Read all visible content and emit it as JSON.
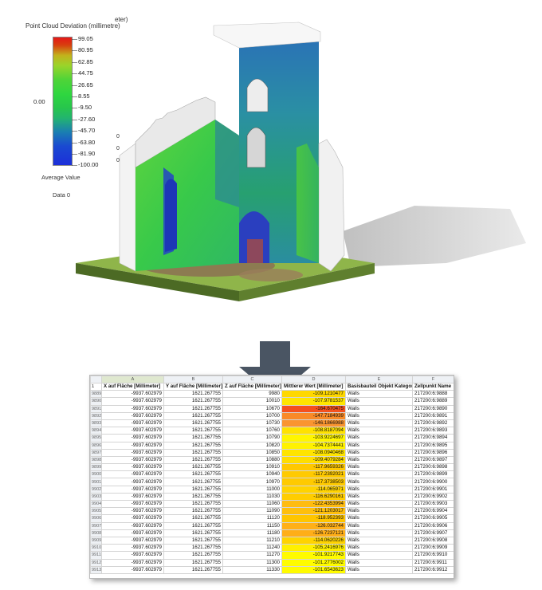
{
  "legend": {
    "title": "Point Cloud Deviation (millimetre)",
    "title_truncated_suffix": "eter)",
    "ticks": [
      "99.05",
      "80.95",
      "62.85",
      "44.75",
      "26.65",
      "8.55",
      "-9.50",
      "-27.60",
      "-45.70",
      "-63.80",
      "-81.90",
      "-100.00"
    ],
    "zero_label": "0.00",
    "average_label": "Average Value",
    "data_label": "Data 0",
    "stray_marks": [
      "0",
      "0",
      "0"
    ]
  },
  "colors": {
    "high": "#e51818",
    "mid": "#2ed640",
    "low": "#1c2fd9",
    "highlight_yellow": "#ffff00",
    "highlight_orange": "#ff7f1e"
  },
  "sheet": {
    "column_letters": [
      "A",
      "B",
      "C",
      "D",
      "E",
      "F"
    ],
    "header_row_number": "1",
    "headers": [
      "X auf Fläche [Millimeter]",
      "Y auf Fläche [Millimeter]",
      "Z auf Fläche [Millimeter]",
      "Mittlerer Wert [Millimeter]",
      "Basisbauteil Objekt Kategorie",
      "Zellpunkt Name"
    ],
    "rows": [
      {
        "n": "9889",
        "x": "-9937.602979",
        "y": "1621.267755",
        "z": "9980",
        "d": "-109.1210477",
        "cat": "Walls",
        "name": "217200:6:9888",
        "color": "#ffd800"
      },
      {
        "n": "9890",
        "x": "-9937.602979",
        "y": "1621.267755",
        "z": "10010",
        "d": "-107.9781537",
        "cat": "Walls",
        "name": "217200:6:9889",
        "color": "#ffe600"
      },
      {
        "n": "9891",
        "x": "-9937.602979",
        "y": "1621.267755",
        "z": "10670",
        "d": "-164.670475",
        "cat": "Walls",
        "name": "217200:6:9890",
        "color": "#f4511e"
      },
      {
        "n": "9892",
        "x": "-9937.602979",
        "y": "1621.267755",
        "z": "10700",
        "d": "-147.7184939",
        "cat": "Walls",
        "name": "217200:6:9891",
        "color": "#f98a28"
      },
      {
        "n": "9893",
        "x": "-9937.602979",
        "y": "1621.267755",
        "z": "10730",
        "d": "-146.1866988",
        "cat": "Walls",
        "name": "217200:6:9892",
        "color": "#fa9530"
      },
      {
        "n": "9894",
        "x": "-9937.602979",
        "y": "1621.267755",
        "z": "10760",
        "d": "-108.8187094",
        "cat": "Walls",
        "name": "217200:6:9893",
        "color": "#ffe200"
      },
      {
        "n": "9895",
        "x": "-9937.602979",
        "y": "1621.267755",
        "z": "10790",
        "d": "-103.9224697",
        "cat": "Walls",
        "name": "217200:6:9894",
        "color": "#fff600"
      },
      {
        "n": "9896",
        "x": "-9937.602979",
        "y": "1621.267755",
        "z": "10820",
        "d": "-104.7374441",
        "cat": "Walls",
        "name": "217200:6:9895",
        "color": "#fff200"
      },
      {
        "n": "9897",
        "x": "-9937.602979",
        "y": "1621.267755",
        "z": "10850",
        "d": "-108.0940468",
        "cat": "Walls",
        "name": "217200:6:9896",
        "color": "#ffe400"
      },
      {
        "n": "9898",
        "x": "-9937.602979",
        "y": "1621.267755",
        "z": "10880",
        "d": "-109.4079284",
        "cat": "Walls",
        "name": "217200:6:9897",
        "color": "#ffdd00"
      },
      {
        "n": "9899",
        "x": "-9937.602979",
        "y": "1621.267755",
        "z": "10910",
        "d": "-117.9659326",
        "cat": "Walls",
        "name": "217200:6:9898",
        "color": "#ffc800"
      },
      {
        "n": "9900",
        "x": "-9937.602979",
        "y": "1621.267755",
        "z": "10940",
        "d": "-117.2392021",
        "cat": "Walls",
        "name": "217200:6:9899",
        "color": "#ffca00"
      },
      {
        "n": "9901",
        "x": "-9937.602979",
        "y": "1621.267755",
        "z": "10970",
        "d": "-117.3738503",
        "cat": "Walls",
        "name": "217200:6:9900",
        "color": "#ffca00"
      },
      {
        "n": "9902",
        "x": "-9937.602979",
        "y": "1621.267755",
        "z": "11000",
        "d": "-114.065971",
        "cat": "Walls",
        "name": "217200:6:9901",
        "color": "#ffd300"
      },
      {
        "n": "9903",
        "x": "-9937.602979",
        "y": "1621.267755",
        "z": "11030",
        "d": "-116.6290161",
        "cat": "Walls",
        "name": "217200:6:9902",
        "color": "#ffcd00"
      },
      {
        "n": "9904",
        "x": "-9937.602979",
        "y": "1621.267755",
        "z": "11060",
        "d": "-122.4353994",
        "cat": "Walls",
        "name": "217200:6:9903",
        "color": "#ffbc10"
      },
      {
        "n": "9905",
        "x": "-9937.602979",
        "y": "1621.267755",
        "z": "11090",
        "d": "-121.1203017",
        "cat": "Walls",
        "name": "217200:6:9904",
        "color": "#ffbf0c"
      },
      {
        "n": "9906",
        "x": "-9937.602979",
        "y": "1621.267755",
        "z": "11120",
        "d": "-118.952393",
        "cat": "Walls",
        "name": "217200:6:9905",
        "color": "#ffc500"
      },
      {
        "n": "9907",
        "x": "-9937.602979",
        "y": "1621.267755",
        "z": "11150",
        "d": "-126.032744",
        "cat": "Walls",
        "name": "217200:6:9906",
        "color": "#ffb018"
      },
      {
        "n": "9908",
        "x": "-9937.602979",
        "y": "1621.267755",
        "z": "11180",
        "d": "-126.7237121",
        "cat": "Walls",
        "name": "217200:6:9907",
        "color": "#ffae18"
      },
      {
        "n": "9909",
        "x": "-9937.602979",
        "y": "1621.267755",
        "z": "11210",
        "d": "-114.0620226",
        "cat": "Walls",
        "name": "217200:6:9908",
        "color": "#ffd300"
      },
      {
        "n": "9910",
        "x": "-9937.602979",
        "y": "1621.267755",
        "z": "11240",
        "d": "-105.2416976",
        "cat": "Walls",
        "name": "217200:6:9909",
        "color": "#fff000"
      },
      {
        "n": "9911",
        "x": "-9937.602979",
        "y": "1621.267755",
        "z": "11270",
        "d": "-101.9217743",
        "cat": "Walls",
        "name": "217200:6:9910",
        "color": "#fffb00"
      },
      {
        "n": "9912",
        "x": "-9937.602979",
        "y": "1621.267755",
        "z": "11300",
        "d": "-101.2776002",
        "cat": "Walls",
        "name": "217200:6:9911",
        "color": "#fffc00"
      },
      {
        "n": "9913",
        "x": "-9937.602979",
        "y": "1621.267755",
        "z": "11330",
        "d": "-101.6543623",
        "cat": "Walls",
        "name": "217200:6:9912",
        "color": "#fffb00"
      }
    ]
  }
}
